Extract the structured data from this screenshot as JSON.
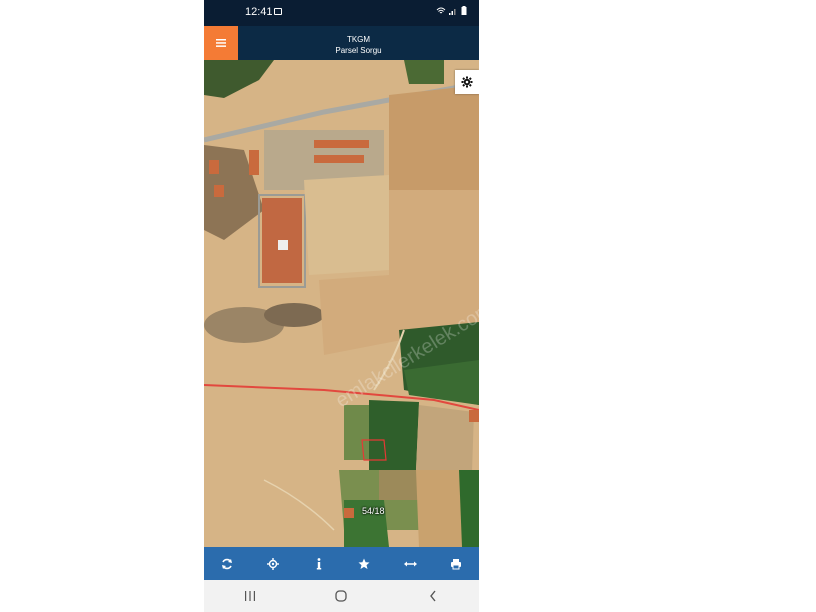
{
  "status_bar": {
    "time": "12:41",
    "icons": [
      "image-icon",
      "wifi-icon",
      "signal-icon",
      "battery-icon"
    ]
  },
  "app_bar": {
    "title": "TKGM",
    "subtitle": "Parsel Sorgu",
    "menu_icon": "hamburger-menu-icon"
  },
  "map": {
    "parcel_label": "54/18",
    "watermark": "emlakcilerkelek.com",
    "settings_icon": "gear-icon"
  },
  "toolbar": {
    "buttons": [
      "refresh-icon",
      "locate-icon",
      "info-icon",
      "star-icon",
      "measure-icon",
      "print-icon"
    ]
  },
  "nav_bar": {
    "buttons": [
      "recent-apps-icon",
      "home-icon",
      "back-icon"
    ]
  },
  "colors": {
    "status_bar": "#0a1d33",
    "app_bar": "#0c2a45",
    "menu_accent": "#f47b35",
    "toolbar": "#2b6cad",
    "parcel_border": "#e53935"
  }
}
